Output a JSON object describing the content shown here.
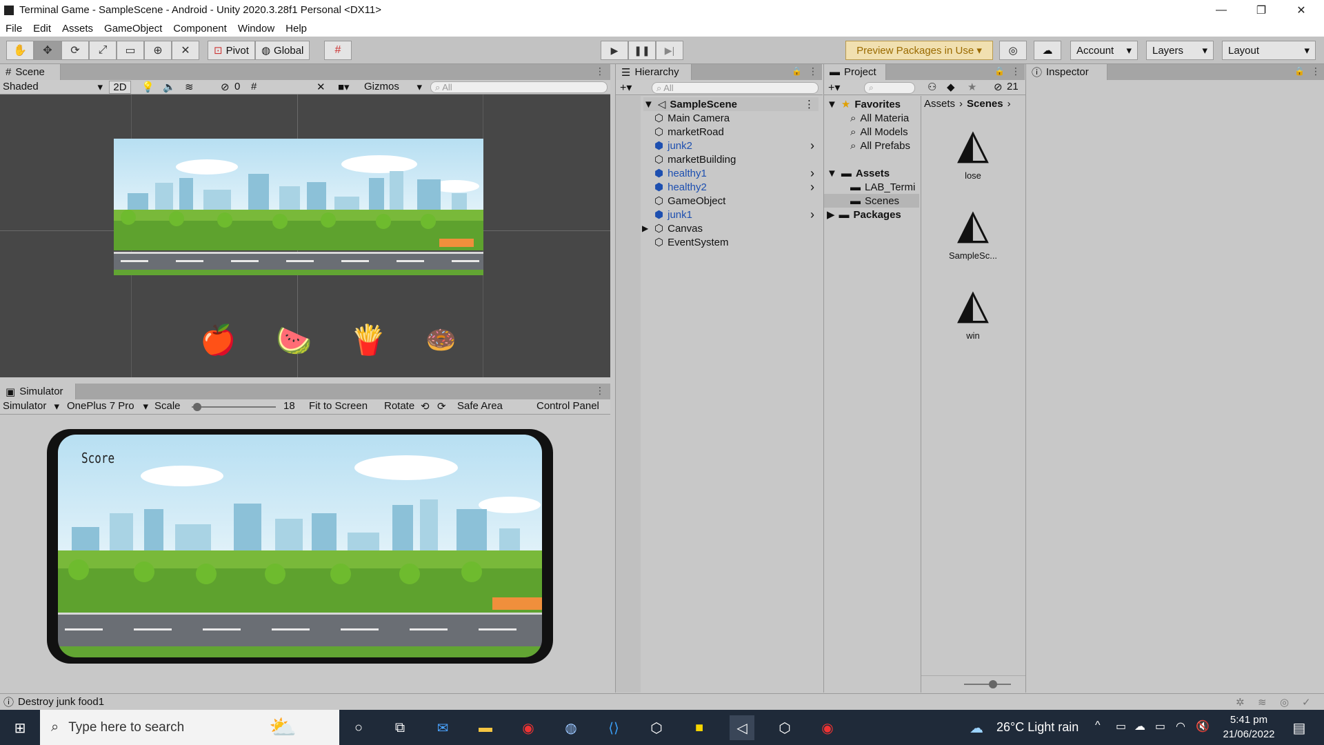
{
  "window": {
    "title": "Terminal Game - SampleScene - Android - Unity 2020.3.28f1 Personal <DX11>",
    "controls": [
      "—",
      "❐",
      "✕"
    ]
  },
  "menu": [
    "File",
    "Edit",
    "Assets",
    "GameObject",
    "Component",
    "Window",
    "Help"
  ],
  "toolbar": {
    "pivot": "Pivot",
    "global": "Global",
    "preview_packages": "Preview Packages in Use ▾",
    "account": "Account",
    "layers": "Layers",
    "layout": "Layout"
  },
  "scene": {
    "tab": "Scene",
    "shading": "Shaded",
    "mode_2d": "2D",
    "hidden_count": "0",
    "gizmos": "Gizmos",
    "search_placeholder": "All"
  },
  "simulator": {
    "tab": "Simulator",
    "mode": "Simulator",
    "device": "OnePlus 7 Pro",
    "scale_label": "Scale",
    "scale_value": "18",
    "scale_fraction": 0.02,
    "fit": "Fit to Screen",
    "rotate": "Rotate",
    "safe_area": "Safe Area",
    "control_panel": "Control Panel",
    "score_label": "Score"
  },
  "hierarchy": {
    "tab": "Hierarchy",
    "search_placeholder": "All",
    "scene_name": "SampleScene",
    "items": [
      {
        "label": "Main Camera",
        "prefab": false,
        "expandable": false
      },
      {
        "label": "marketRoad",
        "prefab": false,
        "expandable": false
      },
      {
        "label": "junk2",
        "prefab": true,
        "expandable": false
      },
      {
        "label": "marketBuilding",
        "prefab": false,
        "expandable": false
      },
      {
        "label": "healthy1",
        "prefab": true,
        "expandable": false
      },
      {
        "label": "healthy2",
        "prefab": true,
        "expandable": false
      },
      {
        "label": "GameObject",
        "prefab": false,
        "expandable": false
      },
      {
        "label": "junk1",
        "prefab": true,
        "expandable": false
      },
      {
        "label": "Canvas",
        "prefab": false,
        "expandable": true
      },
      {
        "label": "EventSystem",
        "prefab": false,
        "expandable": false
      }
    ]
  },
  "project": {
    "tab": "Project",
    "hidden_count": "21",
    "favorites_label": "Favorites",
    "favorites": [
      "All Materia",
      "All Models",
      "All Prefabs"
    ],
    "assets_label": "Assets",
    "asset_folders": [
      "LAB_Termi",
      "Scenes"
    ],
    "packages_label": "Packages",
    "breadcrumb": [
      "Assets",
      "Scenes"
    ],
    "scene_files": [
      "lose",
      "SampleSc...",
      "win"
    ]
  },
  "inspector": {
    "tab": "Inspector"
  },
  "status": {
    "message": "Destroy  junk food1"
  },
  "taskbar": {
    "search_placeholder": "Type here to search",
    "weather": "26°C  Light rain",
    "time": "5:41 pm",
    "date": "21/06/2022"
  },
  "colors": {
    "panel_bg": "#c8c8c8",
    "scene_bg": "#474747",
    "accent_blue": "#1d4fb0",
    "taskbar_bg": "#1f2a39",
    "preview_bg": "#f1e0b0"
  }
}
